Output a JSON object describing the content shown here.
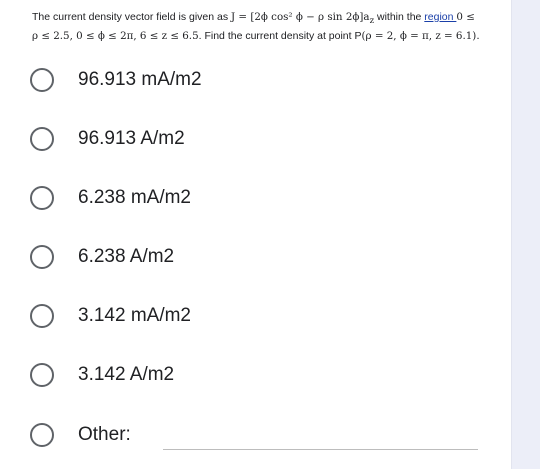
{
  "question": {
    "line1_prefix": "The current density vector field is given as ",
    "line1_math": "J = [2ϕ cos² ϕ − ρ sin 2ϕ]a",
    "line1_sub": "z",
    "line1_middle": " within the ",
    "line1_link": "region ",
    "line1_suffix": "0 ≤",
    "line2_math": "ρ ≤ 2.5, 0 ≤ ϕ ≤ 2π, 6 ≤ z ≤ 6.5",
    "line2_text": ". Find the current density at point P",
    "line2_point": "(ρ = 2, ϕ = π, z = 6.1)."
  },
  "options": [
    {
      "label": "96.913 mA/m2"
    },
    {
      "label": "96.913 A/m2"
    },
    {
      "label": "6.238 mA/m2"
    },
    {
      "label": "6.238 A/m2"
    },
    {
      "label": "3.142 mA/m2"
    },
    {
      "label": "3.142 A/m2"
    },
    {
      "label": "Other:"
    }
  ],
  "colors": {
    "radio_border": "#5f6368",
    "text": "#202124",
    "link": "#1a3fa8",
    "side_panel": "#eceef8"
  }
}
